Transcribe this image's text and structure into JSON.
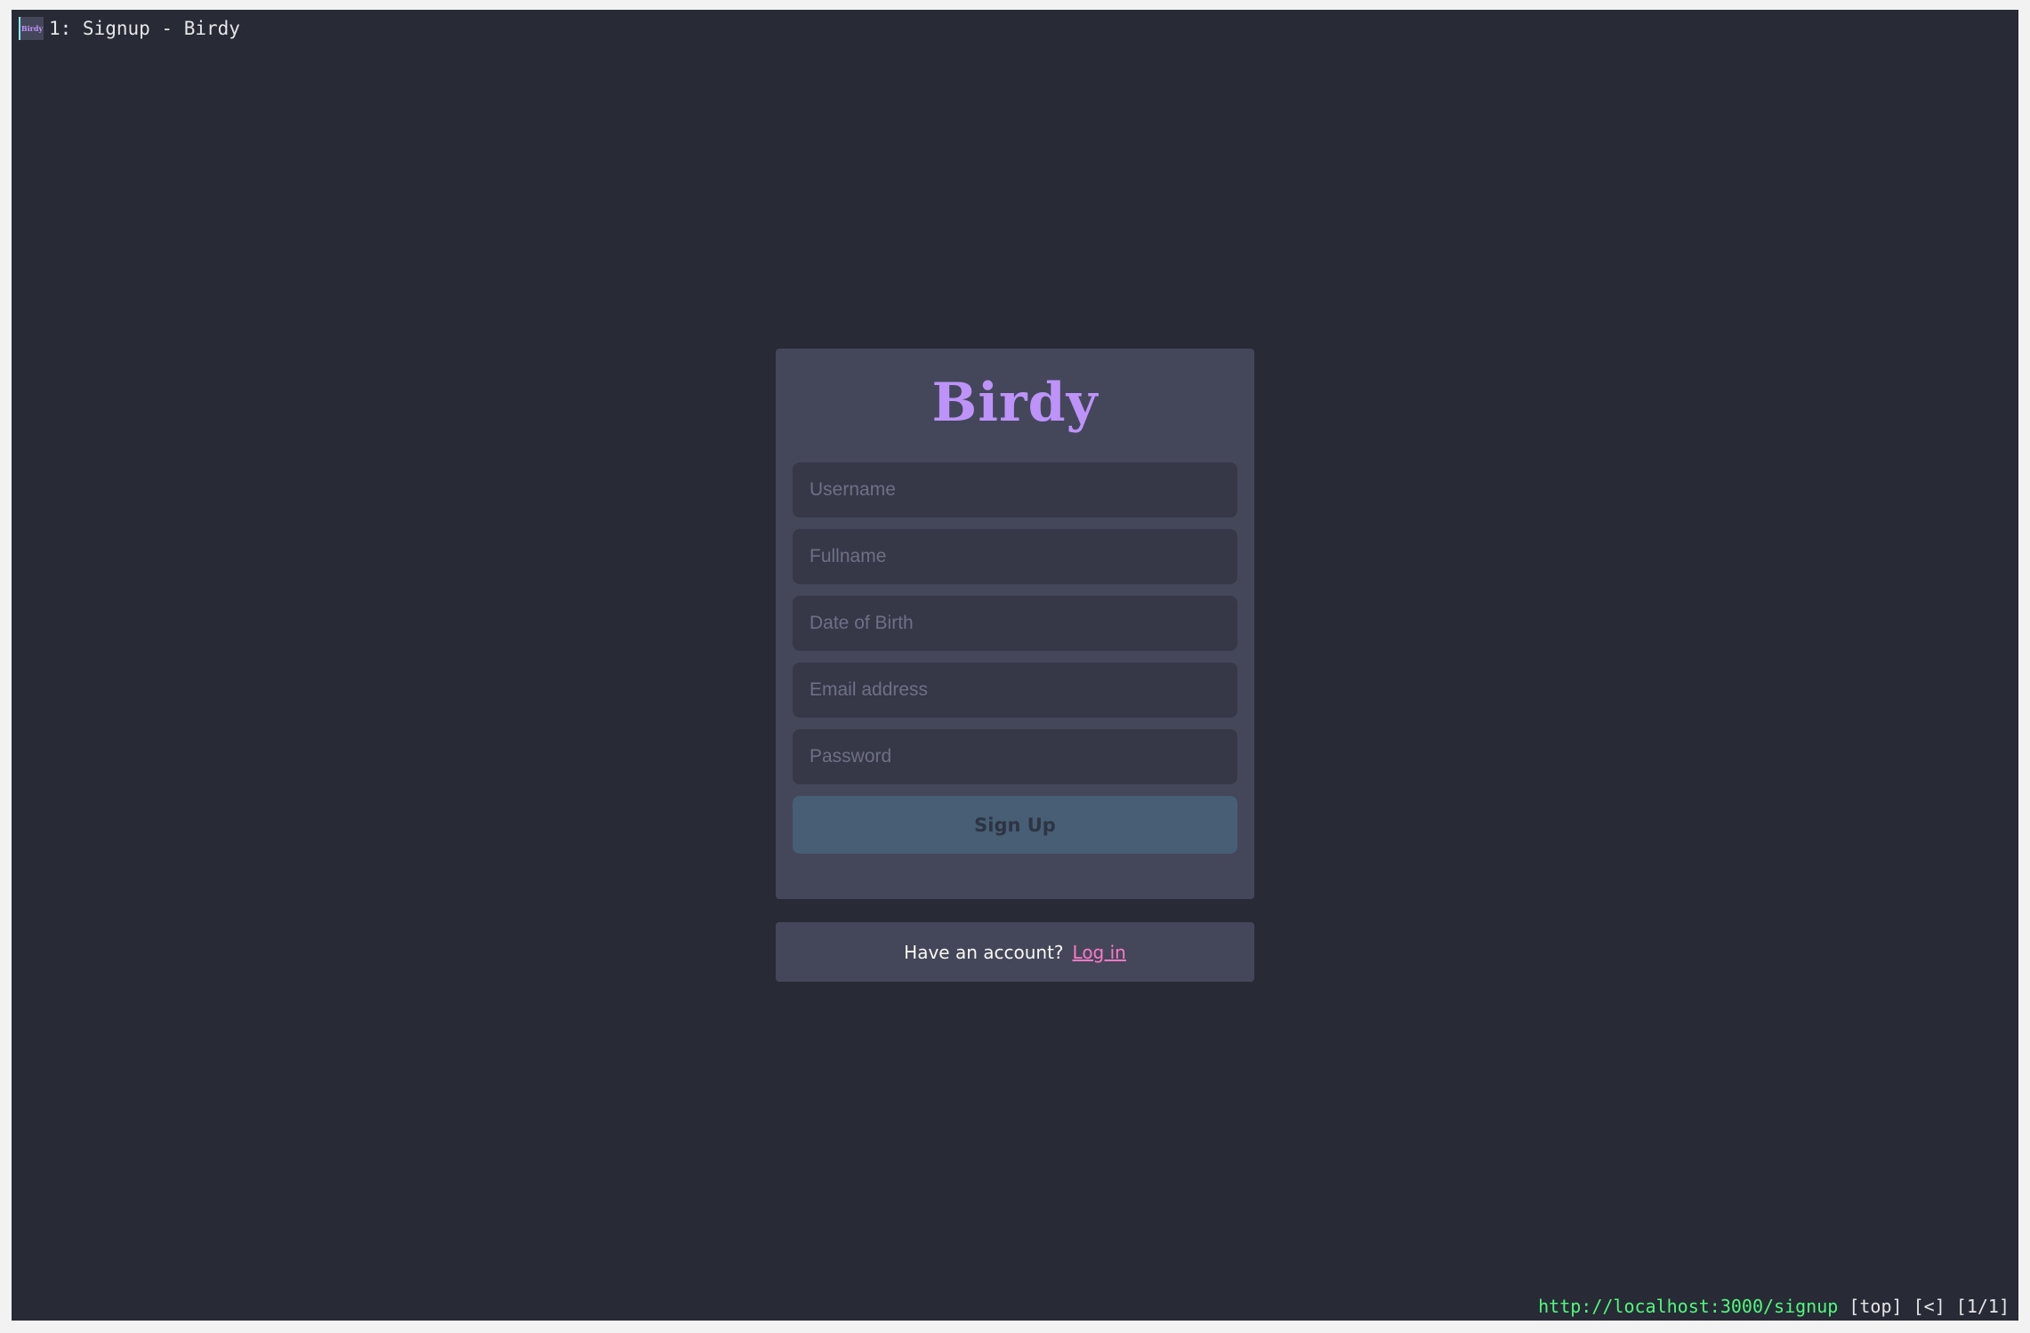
{
  "window": {
    "title": "1: Signup - Birdy",
    "favicon_text": "Birdy"
  },
  "signup": {
    "logo": "Birdy",
    "fields": {
      "username_placeholder": "Username",
      "fullname_placeholder": "Fullname",
      "dob_placeholder": "Date of Birth",
      "email_placeholder": "Email address",
      "password_placeholder": "Password"
    },
    "submit_label": "Sign Up"
  },
  "login_prompt": {
    "text": "Have an account?",
    "link_label": "Log in"
  },
  "statusbar": {
    "url": "http://localhost:3000/signup",
    "position": "[top]",
    "history": "[<]",
    "tabs": "[1/1]"
  },
  "colors": {
    "background": "#282a36",
    "card": "#44475a",
    "logo": "#bd93f9",
    "link": "#ff79c6",
    "url": "#50fa7b",
    "button": "#475e74"
  }
}
